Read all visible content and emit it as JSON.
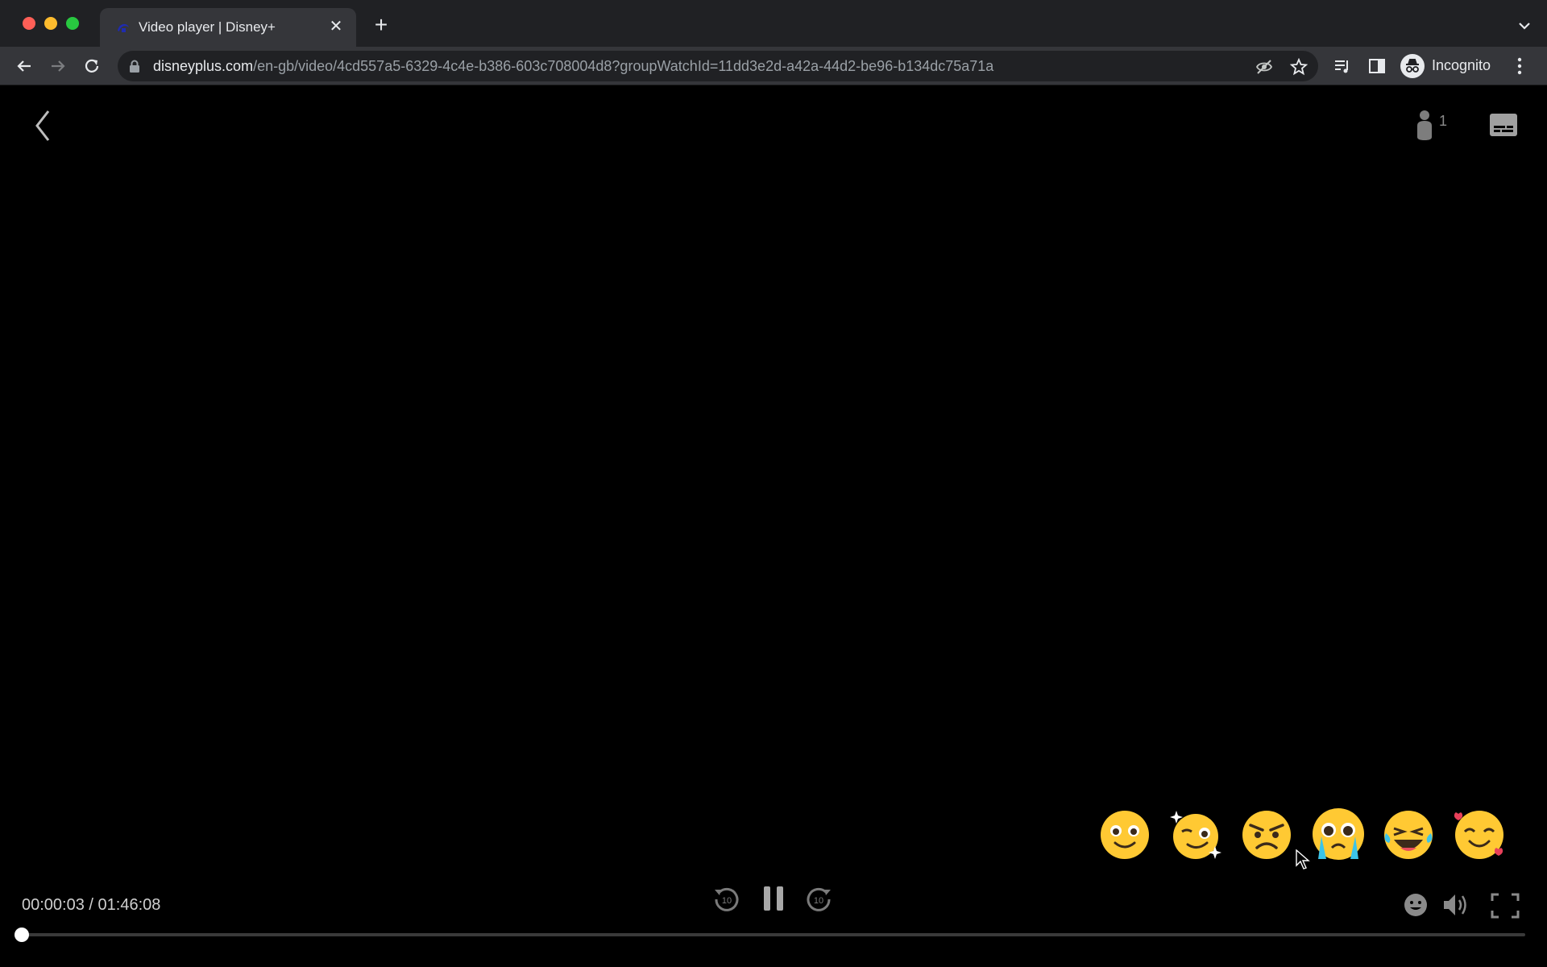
{
  "browser": {
    "tab": {
      "title": "Video player | Disney+"
    },
    "url": {
      "host": "disneyplus.com",
      "path": "/en-gb/video/4cd557a5-6329-4c4e-b386-603c708004d8?groupWatchId=11dd3e2d-a42a-44d2-be96-b134dc75a71a"
    },
    "profile_label": "Incognito"
  },
  "player": {
    "viewer_count": "1",
    "time_display": "00:00:03 / 01:46:08",
    "progress": 0.0005,
    "reactions": [
      {
        "name": "smiling-face-reaction"
      },
      {
        "name": "sparkle-wink-reaction"
      },
      {
        "name": "angry-face-reaction"
      },
      {
        "name": "crying-face-reaction"
      },
      {
        "name": "laughing-face-reaction"
      },
      {
        "name": "love-face-reaction"
      }
    ],
    "controls": {
      "rewind_label": "10",
      "forward_label": "10"
    }
  },
  "colors": {
    "emoji_yellow": "#ffc933",
    "tab_bg": "#35363a",
    "frame_bg": "#202124"
  }
}
